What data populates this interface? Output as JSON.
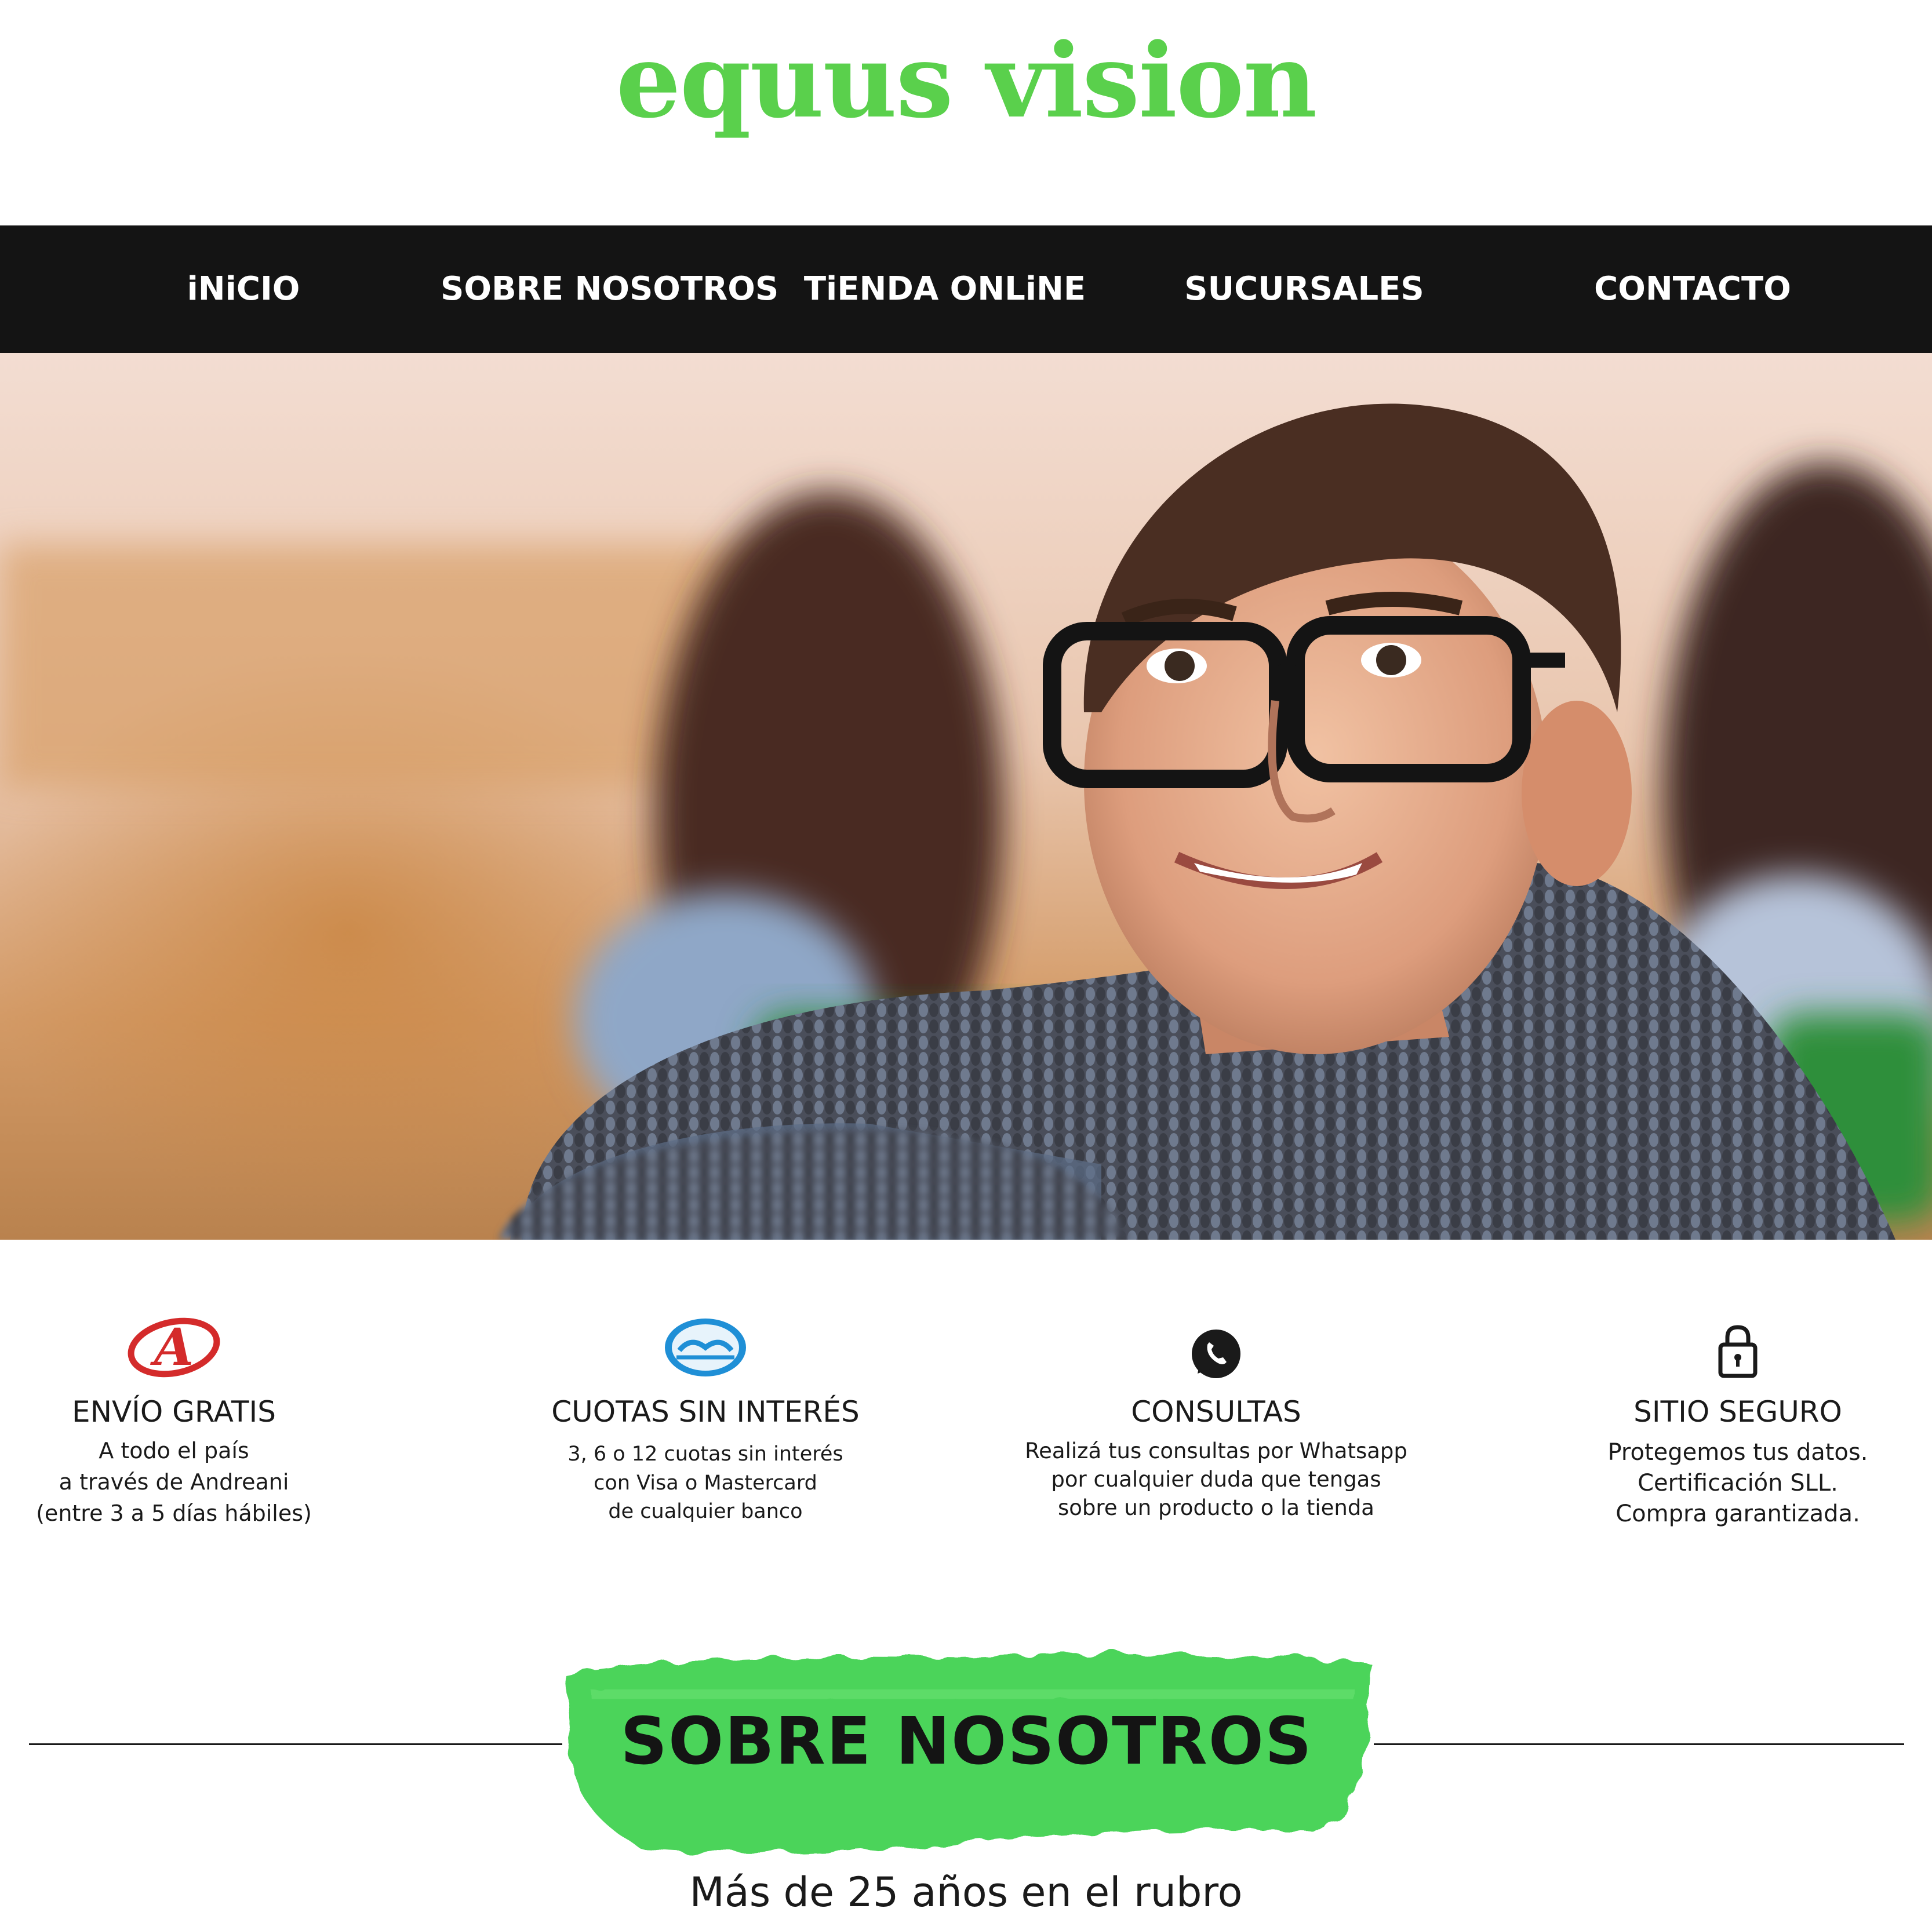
{
  "brand": {
    "logo_text": "equus vision",
    "accent_color": "#5ad04c"
  },
  "nav": {
    "background": "#141414",
    "items": [
      {
        "label": "iNiCIO"
      },
      {
        "label": "SOBRE NOSOTROS"
      },
      {
        "label": "TiENDA ONLiNE"
      },
      {
        "label": "SUCURSALES"
      },
      {
        "label": "CONTACTO"
      }
    ]
  },
  "features": [
    {
      "icon": "andreani-logo-icon",
      "title": "ENVÍO GRATIS",
      "lines": [
        "A todo el país",
        "a través de Andreani",
        "(entre 3 a 5 días hábiles)"
      ]
    },
    {
      "icon": "mercadopago-handshake-icon",
      "title": "CUOTAS SIN INTERÉS",
      "lines": [
        "3, 6 o 12 cuotas sin interés",
        "con Visa o Mastercard",
        "de cualquier banco"
      ]
    },
    {
      "icon": "whatsapp-icon",
      "title": "CONSULTAS",
      "lines": [
        "Realizá tus consultas por Whatsapp",
        "por cualquier duda que tengas",
        "sobre un producto o la tienda"
      ]
    },
    {
      "icon": "lock-icon",
      "title": "SITIO SEGURO",
      "lines": [
        "Protegemos tus datos.",
        "Certificación SLL.",
        "Compra garantizada."
      ]
    }
  ],
  "about": {
    "title": "SOBRE NOSOTROS",
    "subtitle": "Más de 25 años en el rubro"
  }
}
